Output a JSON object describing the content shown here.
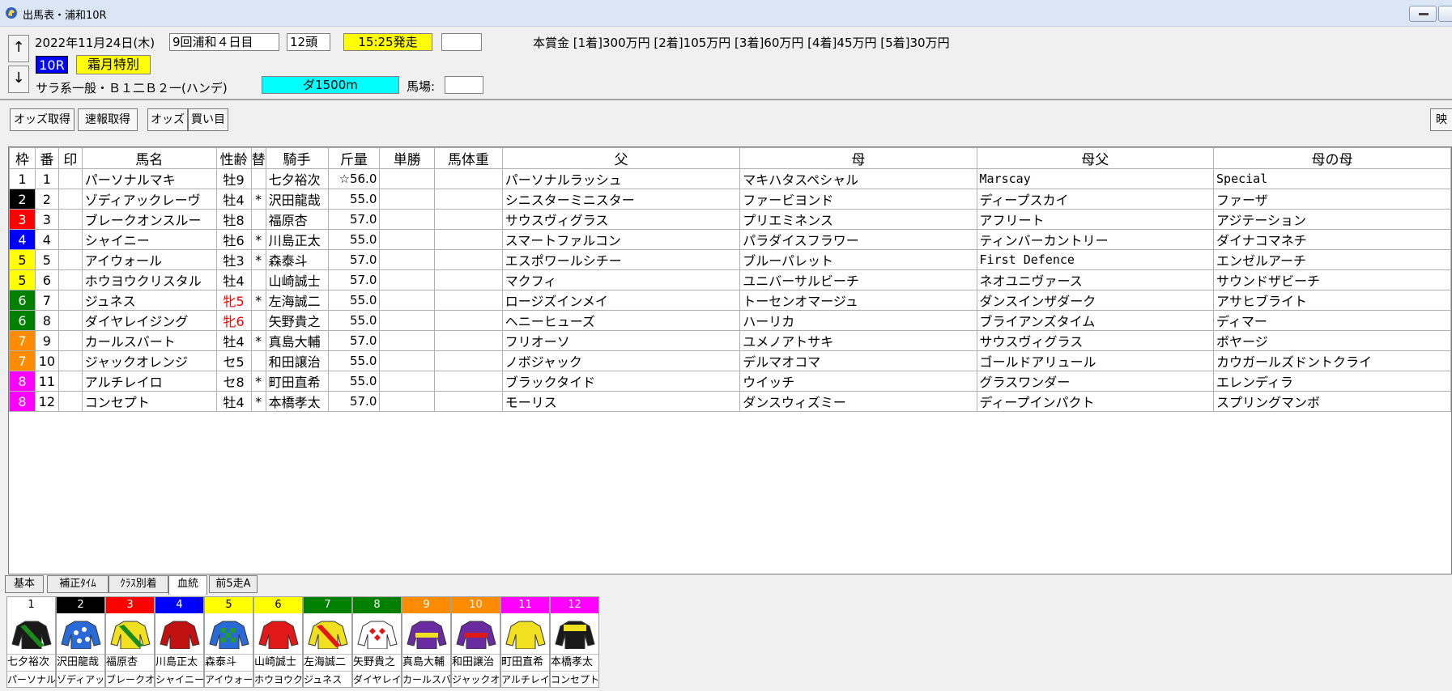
{
  "window": {
    "title": "出馬表・浦和10R"
  },
  "header": {
    "date": "2022年11月24日(木)",
    "meeting": "9回浦和４日目",
    "entries": "12頭",
    "post_time": "15:25発走",
    "prize": "本賞金 [1着]300万円 [2着]105万円 [3着]60万円 [4着]45万円 [5着]30万円",
    "race_number": "10R",
    "race_name": "霜月特別",
    "race_class": "サラ系一般・Ｂ１二Ｂ２一(ハンデ)",
    "course": "ダ1500m",
    "track_label": "馬場:",
    "up_arrow": "↑",
    "down_arrow": "↓"
  },
  "toolbar": {
    "odds_get": "オッズ取得",
    "renpuku_get": "速報取得",
    "odds": "オッズ",
    "kaime": "買い目",
    "movie": "映"
  },
  "table": {
    "headers": [
      "枠",
      "番",
      "印",
      "馬名",
      "性齢",
      "替",
      "騎手",
      "斤量",
      "単勝",
      "馬体重",
      "父",
      "母",
      "母父",
      "母の母"
    ],
    "rows": [
      {
        "waku": "1",
        "ban": "1",
        "name": "パーソナルマキ",
        "sexage": "牡9",
        "kae": "",
        "jockey": "七夕裕次",
        "weight": "☆56.0",
        "sire": "パーソナルラッシュ",
        "dam": "マキハタスペシャル",
        "damsire": "Marscay",
        "damdam": "Special"
      },
      {
        "waku": "2",
        "ban": "2",
        "name": "ゾディアックレーヴ",
        "sexage": "牡4",
        "kae": "*",
        "jockey": "沢田龍哉",
        "weight": "55.0",
        "sire": "シニスターミニスター",
        "dam": "ファービヨンド",
        "damsire": "ディープスカイ",
        "damdam": "ファーザ"
      },
      {
        "waku": "3",
        "ban": "3",
        "name": "ブレークオンスルー",
        "sexage": "牡8",
        "kae": "",
        "jockey": "福原杏",
        "weight": "57.0",
        "sire": "サウスヴィグラス",
        "dam": "プリエミネンス",
        "damsire": "アフリート",
        "damdam": "アジテーション"
      },
      {
        "waku": "4",
        "ban": "4",
        "name": "シャイニー",
        "sexage": "牡6",
        "kae": "*",
        "jockey": "川島正太",
        "weight": "55.0",
        "sire": "スマートファルコン",
        "dam": "パラダイスフラワー",
        "damsire": "ティンバーカントリー",
        "damdam": "ダイナコマネチ"
      },
      {
        "waku": "5",
        "ban": "5",
        "name": "アイウォール",
        "sexage": "牡3",
        "kae": "*",
        "jockey": "森泰斗",
        "weight": "57.0",
        "sire": "エスポワールシチー",
        "dam": "ブルーパレット",
        "damsire": "First Defence",
        "damdam": "エンゼルアーチ"
      },
      {
        "waku": "5",
        "ban": "6",
        "name": "ホウヨウクリスタル",
        "sexage": "牡4",
        "kae": "",
        "jockey": "山崎誠士",
        "weight": "57.0",
        "sire": "マクフィ",
        "dam": "ユニバーサルビーチ",
        "damsire": "ネオユニヴァース",
        "damdam": "サウンドザビーチ"
      },
      {
        "waku": "6",
        "ban": "7",
        "name": "ジュネス",
        "sexage": "牝5",
        "kae": "*",
        "jockey": "左海誠二",
        "weight": "55.0",
        "sire": "ロージズインメイ",
        "dam": "トーセンオマージュ",
        "damsire": "ダンスインザダーク",
        "damdam": "アサヒブライト"
      },
      {
        "waku": "6",
        "ban": "8",
        "name": "ダイヤレイジング",
        "sexage": "牝6",
        "kae": "",
        "jockey": "矢野貴之",
        "weight": "55.0",
        "sire": "ヘニーヒューズ",
        "dam": "ハーリカ",
        "damsire": "ブライアンズタイム",
        "damdam": "ディマー"
      },
      {
        "waku": "7",
        "ban": "9",
        "name": "カールスバート",
        "sexage": "牡4",
        "kae": "*",
        "jockey": "真島大輔",
        "weight": "57.0",
        "sire": "フリオーソ",
        "dam": "ユメノアトサキ",
        "damsire": "サウスヴィグラス",
        "damdam": "ボヤージ"
      },
      {
        "waku": "7",
        "ban": "10",
        "name": "ジャックオレンジ",
        "sexage": "セ5",
        "kae": "",
        "jockey": "和田譲治",
        "weight": "55.0",
        "sire": "ノボジャック",
        "dam": "デルマオコマ",
        "damsire": "ゴールドアリュール",
        "damdam": "カウガールズドントクライ"
      },
      {
        "waku": "8",
        "ban": "11",
        "name": "アルチレイロ",
        "sexage": "セ8",
        "kae": "*",
        "jockey": "町田直希",
        "weight": "55.0",
        "sire": "ブラックタイド",
        "dam": "ウイッチ",
        "damsire": "グラスワンダー",
        "damdam": "エレンディラ"
      },
      {
        "waku": "8",
        "ban": "12",
        "name": "コンセプト",
        "sexage": "牡4",
        "kae": "*",
        "jockey": "本橋孝太",
        "weight": "57.0",
        "sire": "モーリス",
        "dam": "ダンスウィズミー",
        "damsire": "ディープインパクト",
        "damdam": "スプリングマンボ"
      }
    ]
  },
  "colors": {
    "waku": {
      "1": "#ffffff",
      "2": "#000000",
      "3": "#ff0000",
      "4": "#0000ff",
      "5": "#ffff00",
      "6": "#008000",
      "7": "#ff8c00",
      "8": "#ff00ff"
    },
    "waku_text": {
      "1": "#000000",
      "2": "#ffffff",
      "3": "#ffffff",
      "4": "#ffffff",
      "5": "#000000",
      "6": "#ffffff",
      "7": "#ffffff",
      "8": "#ffffff"
    },
    "female": "#ff0000"
  },
  "tabs": [
    "基本",
    "補正ﾀｲﾑ",
    "ｸﾗｽ別着",
    "血統",
    "前5走A"
  ],
  "active_tab": 3,
  "silks": [
    {
      "num": "1",
      "jockey": "七夕裕次",
      "horse": "パーソナルマキ",
      "body": "#1a1a1a",
      "accent": "#1a8a1a",
      "pattern": "sash"
    },
    {
      "num": "2",
      "jockey": "沢田龍哉",
      "horse": "ゾディアックレーヴ",
      "body": "#2a6ad8",
      "accent": "#ffffff",
      "pattern": "stars"
    },
    {
      "num": "3",
      "jockey": "福原杏",
      "horse": "ブレークオンスルー",
      "body": "#f0e020",
      "accent": "#1a8a1a",
      "pattern": "sash"
    },
    {
      "num": "4",
      "jockey": "川島正太",
      "horse": "シャイニー",
      "body": "#c01010",
      "accent": "#ffffff",
      "pattern": "plain"
    },
    {
      "num": "5",
      "jockey": "森泰斗",
      "horse": "アイウォール",
      "body": "#2a6ad8",
      "accent": "#20a020",
      "pattern": "checks"
    },
    {
      "num": "6",
      "jockey": "山崎誠士",
      "horse": "ホウヨウクリスタル",
      "body": "#e01818",
      "accent": "#e01818",
      "pattern": "plain"
    },
    {
      "num": "7",
      "jockey": "左海誠二",
      "horse": "ジュネス",
      "body": "#f0e020",
      "accent": "#e01818",
      "pattern": "sash"
    },
    {
      "num": "8",
      "jockey": "矢野貴之",
      "horse": "ダイヤレイジング",
      "body": "#ffffff",
      "accent": "#e01818",
      "pattern": "diamonds"
    },
    {
      "num": "9",
      "jockey": "真島大輔",
      "horse": "カールスバート",
      "body": "#6a2aa0",
      "accent": "#f0e020",
      "pattern": "hoop"
    },
    {
      "num": "10",
      "jockey": "和田譲治",
      "horse": "ジャックオレンジ",
      "body": "#6a2aa0",
      "accent": "#e01818",
      "pattern": "hoop"
    },
    {
      "num": "11",
      "jockey": "町田直希",
      "horse": "アルチレイロ",
      "body": "#f0e020",
      "accent": "#f0e020",
      "pattern": "plain"
    },
    {
      "num": "12",
      "jockey": "本橋孝太",
      "horse": "コンセプト",
      "body": "#1a1a1a",
      "accent": "#f0e020",
      "pattern": "yoke"
    }
  ]
}
